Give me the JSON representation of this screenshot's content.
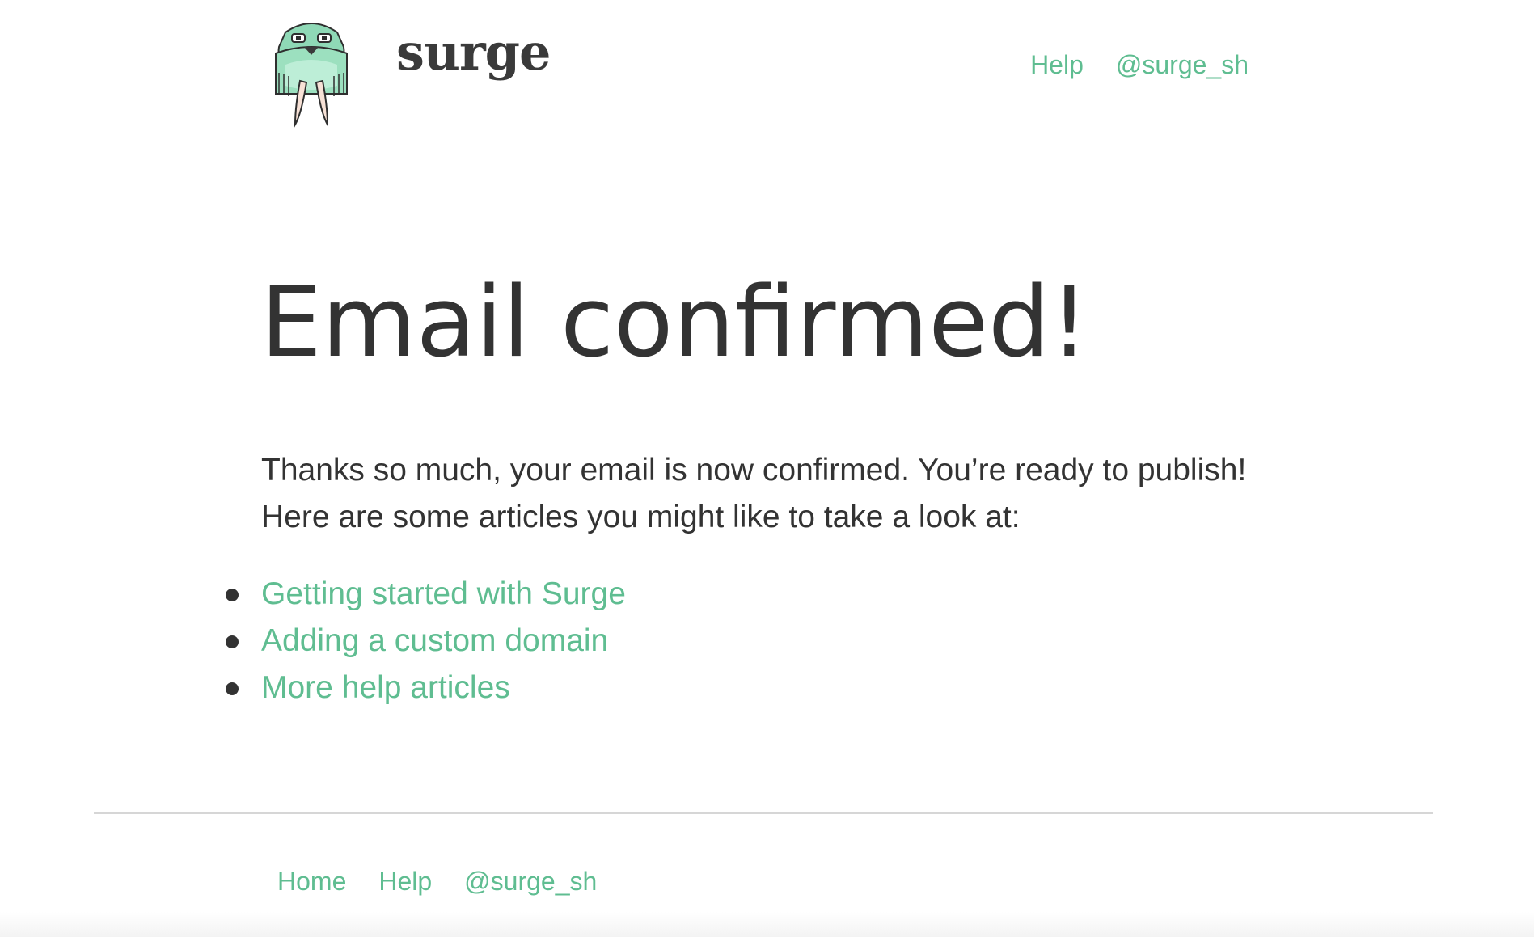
{
  "header": {
    "brand": "surge",
    "logo_icon": "walrus-logo-icon",
    "nav": [
      {
        "label": "Help"
      },
      {
        "label": "@surge_sh"
      }
    ]
  },
  "main": {
    "title": "Email confirmed!",
    "intro_line1": "Thanks so much, your email is now confirmed. You’re ready to publish!",
    "intro_line2": "Here are some articles you might like to take a look at:",
    "articles": [
      {
        "label": "Getting started with Surge"
      },
      {
        "label": "Adding a custom domain"
      },
      {
        "label": "More help articles"
      }
    ]
  },
  "footer": {
    "nav": [
      {
        "label": "Home"
      },
      {
        "label": "Help"
      },
      {
        "label": "@surge_sh"
      }
    ]
  },
  "colors": {
    "accent": "#5fbd91",
    "text": "#333333",
    "divider": "#d6d6d6",
    "logo_green": "#8fd9b6"
  }
}
